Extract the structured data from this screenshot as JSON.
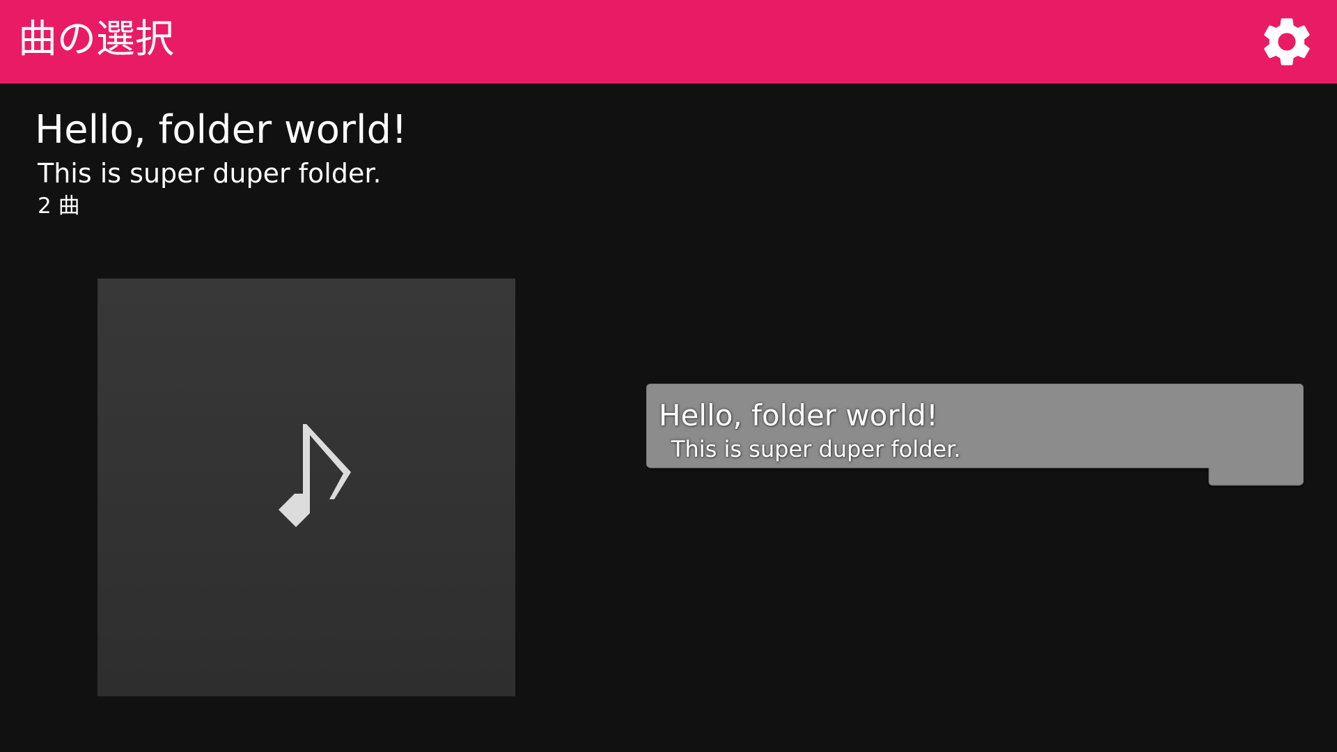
{
  "header": {
    "title": "曲の選択",
    "settings_icon": "gear-icon",
    "background_color": "#e91b64"
  },
  "folder": {
    "title": "Hello, folder world!",
    "description": "This is super duper folder.",
    "count": "2 曲"
  },
  "jacket": {
    "icon": "music-note-icon"
  },
  "list": {
    "items": [
      {
        "title": "Hello, folder world!",
        "description": "This is super duper folder."
      }
    ]
  },
  "colors": {
    "accent": "#e91b64",
    "background": "#111111",
    "jacket": "#333333",
    "list_item": "#8c8c8c"
  }
}
